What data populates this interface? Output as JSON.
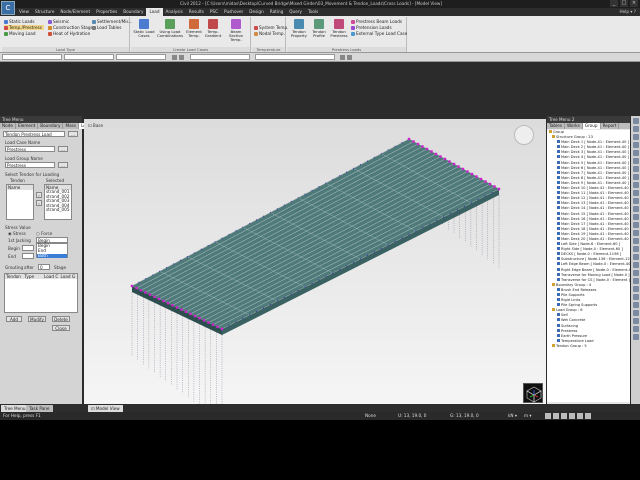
{
  "app": {
    "logo_text": "C",
    "title": "Civil 2012 - [C:\\Users\\midas\\Desktop\\Curved Bridge\\Mixed Girder\\03_Movement & Tendon_Loads\\Cross Loads] - [Model View]",
    "help": "Help"
  },
  "menu": [
    "View",
    "Structure",
    "Node/Element",
    "Properties",
    "Boundary",
    "Load",
    "Analysis",
    "Results",
    "PSC",
    "Pushover",
    "Design",
    "Rating",
    "Query",
    "Tools"
  ],
  "menu_active_index": 5,
  "ribbon": {
    "load_type": {
      "label": "Load Type",
      "items": [
        "Static Loads",
        "Temp./Prestress",
        "Moving Load",
        "Seismic",
        "Construction Stage",
        "Heat of Hydration",
        "Settlement/Mis...",
        "Load Tables"
      ]
    },
    "create_load_cases": {
      "label": "Create Load Cases",
      "buttons": [
        "Static Load Cases",
        "Using Load Combinations",
        "Element Temp.",
        "Temp. Gradient",
        "Beam Section Temp."
      ]
    },
    "temperature_loads": {
      "label": "Temperature Loads",
      "items": [
        "System Temp.",
        "Nodal Temp."
      ]
    },
    "prestress_loads": {
      "label": "Prestress Loads",
      "buttons": [
        "Tendon Property",
        "Tendon Profile",
        "Tendon Prestress"
      ],
      "items": [
        "Prestress Beam Loads",
        "Pretension Loads",
        "External Type Load Case"
      ]
    }
  },
  "left_panel": {
    "title": "Tree Menu",
    "tabs": [
      "Node",
      "Element",
      "Boundary",
      "Mass",
      "Load"
    ],
    "active_tab": 4,
    "dropdown_top": "Tendon Prestress Load",
    "load_case_label": "Load Case Name",
    "load_case_value": "Prestress",
    "load_group_label": "Load Group Name",
    "load_group_value": "Prestress",
    "select_tendon_label": "Select Tendon for Loading",
    "tendon_label": "Tendon",
    "selected_label": "Selected",
    "tendon_col": "Name",
    "selected_col": "Name",
    "selected_items": [
      "strand_001",
      "strand_002",
      "strand_003",
      "strand_004",
      "strand_005"
    ],
    "stress_value_label": "Stress Value",
    "stress_option": "Stress",
    "force_option": "Force",
    "jacking_label": "1st Jacking",
    "jacking_value": "Begin",
    "jacking_options": [
      "Begin",
      "End",
      "Both"
    ],
    "begin_label": "Begin",
    "end_label": "End",
    "grouting_label": "Grouting",
    "after_label": "after",
    "stage_value": "0",
    "stage_suffix": "Stage",
    "table_tendon": "Tendon",
    "table_type": "Type",
    "table_loadcase": "Load C",
    "table_loadgroup": "Load G",
    "add_btn": "Add",
    "modify_btn": "Modify",
    "delete_btn": "Delete",
    "close_btn": "Close"
  },
  "viewport": {
    "tab_label": "Base",
    "bottom_tab": "Model View"
  },
  "right_panel": {
    "title": "Tree Menu 2",
    "tabs": [
      "Tables",
      "Works",
      "Group",
      "Report"
    ],
    "active_tab": 2,
    "tree": [
      "Group",
      "Structure Group : 23",
      "Main Deck 1 [ Node-41 : Element-40 ]",
      "Main Deck 2 [ Node-41 : Element-40 ]",
      "Main Deck 3 [ Node-41 : Element-40 ]",
      "Main Deck 4 [ Node-41 : Element-40 ]",
      "Main Deck 5 [ Node-41 : Element-40 ]",
      "Main Deck 6 [ Node-41 : Element-40 ]",
      "Main Deck 7 [ Node-41 : Element-40 ]",
      "Main Deck 8 [ Node-41 : Element-40 ]",
      "Main Deck 9 [ Node-41 : Element-40 ]",
      "Main Deck 10 [ Node-41 : Element-40 ]",
      "Main Deck 11 [ Node-41 : Element-40 ]",
      "Main Deck 12 [ Node-41 : Element-40 ]",
      "Main Deck 13 [ Node-41 : Element-40 ]",
      "Main Deck 14 [ Node-41 : Element-40 ]",
      "Main Deck 15 [ Node-41 : Element-40 ]",
      "Main Deck 16 [ Node-41 : Element-40 ]",
      "Main Deck 17 [ Node-41 : Element-40 ]",
      "Main Deck 18 [ Node-41 : Element-40 ]",
      "Main Deck 19 [ Node-41 : Element-40 ]",
      "Main Deck 20 [ Node-41 : Element-40 ]",
      "Left Side [ Node-6 : Element-60 ]",
      "Right Side [ Node-0 : Element-60 ]",
      "DECKS [ Node-0 : Element-1196 ]",
      "Substructure [ Node-136 : Element-120 ]",
      "Left Edge Beam [ Node-0 : Element-40 ]",
      "Right Edge Beam [ Node-0 : Element-40 ]",
      "Transverse for Moving Load [ Node-0 ]",
      "Transverse for CS [ Node-0 : Element ]",
      "Boundary Group : 4",
      "Brush End Releases",
      "Pile Supports",
      "Rigid Links",
      "Pile Spring Supports",
      "Load Group : 6",
      "Self",
      "Wet Concrete",
      "Surfacing",
      "Prestress",
      "Earth Pressure",
      "Temperature Load",
      "Tendon Group : 5"
    ]
  },
  "bottom_tabs": [
    "Tree Menu",
    "Task Pane"
  ],
  "status": {
    "help": "For Help, press F1",
    "none": "None",
    "coord1": "U: 13, 19.0, 0",
    "coord2": "G: 13, 19.0, 0",
    "unit1": "kN",
    "unit2": "m"
  },
  "colors": {
    "deck": "#4f7a7a",
    "deck_edge": "#2c4e4e",
    "node": "#3b3bb0",
    "support": "#d020d0"
  }
}
